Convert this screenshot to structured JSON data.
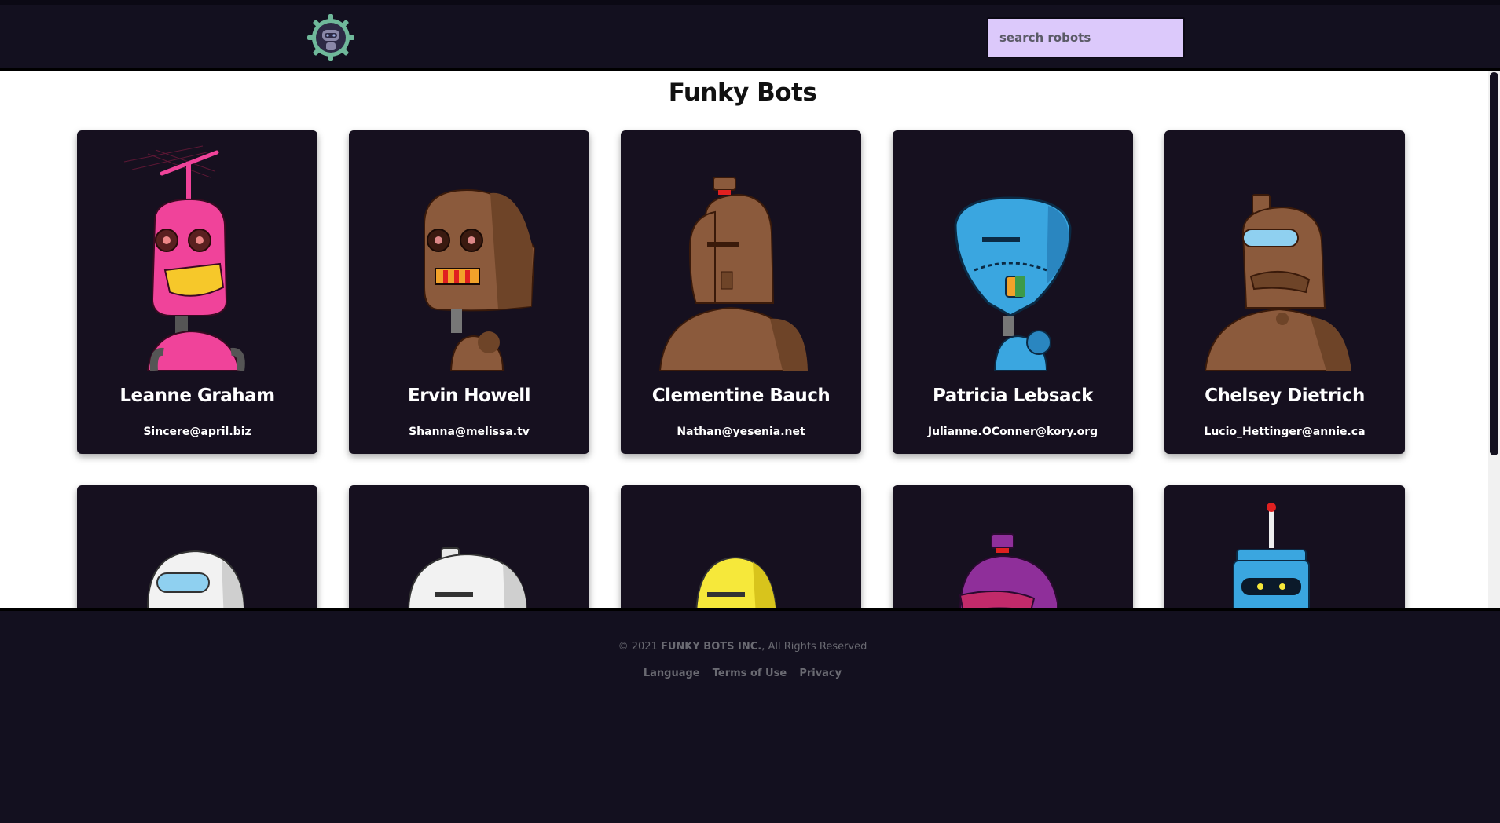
{
  "header": {
    "logo_icon": "robot-gear-logo-icon",
    "search_placeholder": "search robots"
  },
  "main": {
    "title": "Funky Bots",
    "robots": [
      {
        "name": "Leanne Graham",
        "email": "Sincere@april.biz",
        "color": "#f0439a"
      },
      {
        "name": "Ervin Howell",
        "email": "Shanna@melissa.tv",
        "color": "#8b5a3c"
      },
      {
        "name": "Clementine Bauch",
        "email": "Nathan@yesenia.net",
        "color": "#8b5a3c"
      },
      {
        "name": "Patricia Lebsack",
        "email": "Julianne.OConner@kory.org",
        "color": "#3aa6e0"
      },
      {
        "name": "Chelsey Dietrich",
        "email": "Lucio_Hettinger@annie.ca",
        "color": "#8b5a3c"
      },
      {
        "color": "#f2f2f2"
      },
      {
        "color": "#f2f2f2"
      },
      {
        "color": "#f6e83a"
      },
      {
        "color": "#8f2f9a"
      },
      {
        "color": "#3aa6e0"
      }
    ]
  },
  "footer": {
    "copyright_prefix": "© 2021 ",
    "copyright_brand": "FUNKY BOTS INC.",
    "copyright_suffix": ", All Rights Reserved",
    "links": [
      "Language",
      "Terms of Use",
      "Privacy"
    ]
  }
}
